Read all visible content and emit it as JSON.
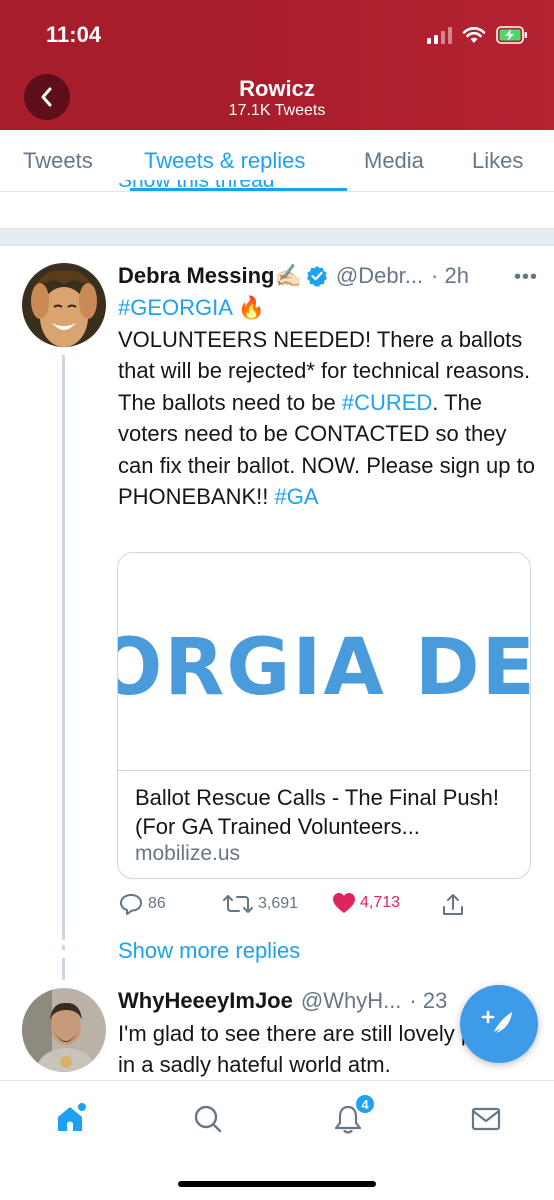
{
  "status_bar": {
    "time": "11:04"
  },
  "header": {
    "title": "Rowicz",
    "subtitle": "17.1K Tweets"
  },
  "tabs": [
    {
      "label": "Tweets",
      "active": false
    },
    {
      "label": "Tweets & replies",
      "active": true
    },
    {
      "label": "Media",
      "active": false
    },
    {
      "label": "Likes",
      "active": false
    }
  ],
  "show_thread": "Show this thread",
  "tweet": {
    "name": "Debra Messing",
    "name_emoji": "✍🏻",
    "handle": "@Debr...",
    "time": "· 2h",
    "hashtag_line": "#GEORGIA",
    "hashtag_emoji": "🔥",
    "text_part1": "VOLUNTEERS NEEDED! There a ballots that will be rejected* for technical reasons. The ballots  need to be ",
    "hashtag_cured": "#CURED",
    "text_part2": ". The voters need to be CONTACTED so they can fix their ballot. NOW. Please sign up to PHONEBANK!! ",
    "hashtag_ga": "#GA",
    "card": {
      "image_text": "ORGIA DEM",
      "title": "Ballot Rescue Calls - The Final Push! (For GA Trained Volunteers...",
      "domain": "mobilize.us"
    },
    "actions": {
      "replies": "86",
      "retweets": "3,691",
      "likes": "4,713"
    }
  },
  "show_more_replies": "Show more replies",
  "tweet2": {
    "name": "WhyHeeeyImJoe",
    "handle": "@WhyH...",
    "time": "· 23",
    "text": "I'm glad to see there are still lovely people in a sadly hateful world atm."
  },
  "bottom_nav": {
    "notifications_badge": "4",
    "items": [
      "home-icon",
      "search-icon",
      "notifications-icon",
      "messages-icon"
    ]
  },
  "colors": {
    "header_bg": "#a81d2c",
    "accent": "#1da1f2",
    "like": "#e0245e"
  }
}
